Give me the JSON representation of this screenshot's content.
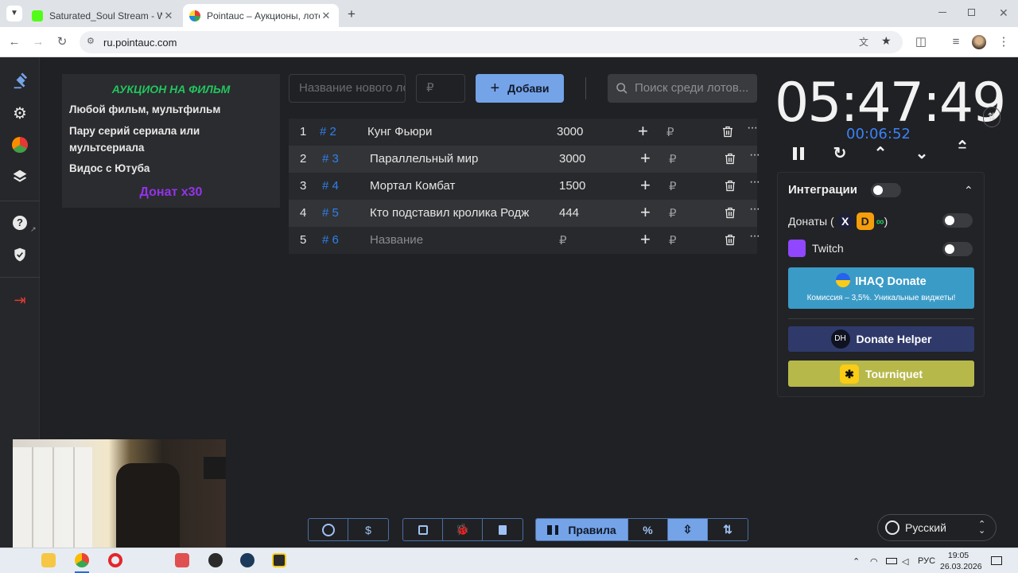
{
  "browser": {
    "tabs": [
      {
        "title": "Saturated_Soul Stream - Watch",
        "favicon_color": "#53fc18"
      },
      {
        "title": "Pointauc – Аукционы, лотереи",
        "favicon_color": "#6b46c1"
      }
    ],
    "new_tab": "+",
    "close_glyph": "✕",
    "url": "ru.pointauc.com"
  },
  "description": {
    "title": "АУКЦИОН НА ФИЛЬМ",
    "lines": [
      "Любой фильм, мультфильм",
      "Пару серий сериала или мультсериала",
      "Видос с Ютуба"
    ],
    "donate": "Донат х30"
  },
  "form": {
    "name_placeholder": "Название нового лота",
    "amount_placeholder": "₽",
    "add_label": "Добави",
    "search_placeholder": "Поиск среди лотов..."
  },
  "lots": [
    {
      "num": "1",
      "id": "# 2",
      "name": "Кунг Фьюри",
      "amount": "3000",
      "currency": "₽",
      "placeholder": false
    },
    {
      "num": "2",
      "id": "# 3",
      "name": "Параллельный мир",
      "amount": "3000",
      "currency": "₽",
      "placeholder": false
    },
    {
      "num": "3",
      "id": "# 4",
      "name": "Мортал Комбат",
      "amount": "1500",
      "currency": "₽",
      "placeholder": false
    },
    {
      "num": "4",
      "id": "# 5",
      "name": "Кто подставил кролика Роджера",
      "amount": "444",
      "currency": "₽",
      "placeholder": false
    },
    {
      "num": "5",
      "id": "# 6",
      "name": "Название",
      "amount": "₽",
      "currency": "₽",
      "placeholder": true
    }
  ],
  "timer": {
    "main": "05:47:49",
    "sub": "00:06:52"
  },
  "integrations": {
    "title": "Интеграции",
    "donations_label": "Донаты (",
    "donations_close": ")",
    "twitch_label": "Twitch",
    "ihaq_title": "IHAQ Donate",
    "ihaq_subtitle": "Комиссия – 3,5%. Уникальные виджеты!",
    "donate_helper": "Donate Helper",
    "donate_helper_logo": "DH",
    "tourniquet": "Tourniquet",
    "colors": {
      "ihaq": "#3b9bc7",
      "donate_helper": "#2f3a6b",
      "tourniquet": "#b7b84a"
    }
  },
  "bottom": {
    "currency_btn": "$",
    "rules": "Правила",
    "percent": "%"
  },
  "language": "Русский",
  "taskbar": {
    "lang": "РУС",
    "time": "19:05",
    "date": "26.03.2026"
  }
}
